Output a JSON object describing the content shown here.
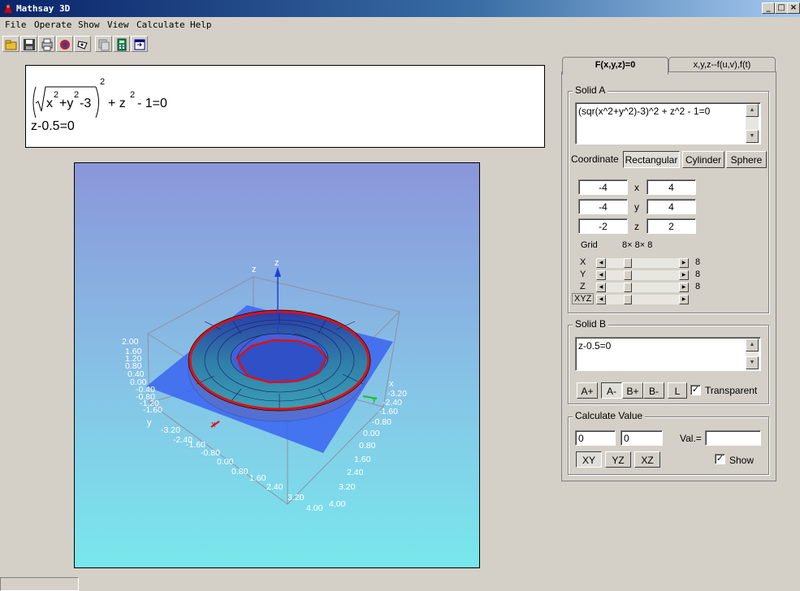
{
  "window": {
    "title": "Mathsay 3D",
    "controls": [
      "_",
      "□",
      "×"
    ]
  },
  "menu": [
    "File",
    "Operate",
    "Show",
    "View",
    "Calculate",
    "Help"
  ],
  "toolbar": [
    "open-icon",
    "save-icon",
    "print-icon",
    "reset-icon",
    "rotate-icon",
    "copy-icon",
    "calculator-icon",
    "window-icon"
  ],
  "formula": {
    "line1": {
      "sqrt_arg": "x",
      "sup_x": "2",
      "plus_y": "+y",
      "sup_y": "2",
      "minus": "-3",
      "outer_sup": "2",
      "rest": "+ z",
      "sup_z": "2",
      "tail": "- 1=0"
    },
    "line2": "z-0.5=0"
  },
  "tabs": {
    "active": "F(x,y,z)=0",
    "inactive": "x,y,z--f(u,v),f(t)"
  },
  "solidA": {
    "label": "Solid A",
    "expression": "(sqr(x^2+y^2)-3)^2 + z^2 - 1=0",
    "coordinate_label": "Coordinate",
    "coord_buttons": [
      "Rectangular",
      "Cylinder",
      "Sphere"
    ],
    "ranges": [
      {
        "min": "-4",
        "axis": "x",
        "max": "4"
      },
      {
        "min": "-4",
        "axis": "y",
        "max": "4"
      },
      {
        "min": "-2",
        "axis": "z",
        "max": "2"
      }
    ],
    "grid_label": "Grid",
    "grid_value": "8× 8× 8",
    "sliders": [
      {
        "label": "X",
        "value": "8"
      },
      {
        "label": "Y",
        "value": "8"
      },
      {
        "label": "Z",
        "value": "8"
      },
      {
        "label": "XYZ",
        "value": ""
      }
    ]
  },
  "solidB": {
    "label": "Solid B",
    "expression": "z-0.5=0",
    "buttons": [
      "A+",
      "A-",
      "B+",
      "B-",
      "L"
    ],
    "transparent_label": "Transparent",
    "transparent_checked": "✓"
  },
  "calculate": {
    "label": "Calculate Value",
    "input1": "0",
    "input2": "0",
    "val_label": "Val.=",
    "val_value": "",
    "buttons": [
      "XY",
      "YZ",
      "XZ"
    ],
    "show_label": "Show",
    "show_checked": "✓"
  },
  "plot": {
    "z_label": "z",
    "z_axis_label": "z",
    "x_label": "x",
    "y_label": "y",
    "x_axis_label": "x",
    "y_axis_label": "y",
    "z_ticks": [
      "2.00",
      "1.60",
      "1.20",
      "0.80",
      "0.40",
      "0.00",
      "-0.40",
      "-0.80",
      "-1.20",
      "-1.60"
    ],
    "x_ticks": [
      "-3.20",
      "-2.40",
      "-1.60",
      "-0.80",
      "0.00",
      "0.80",
      "1.60",
      "2.40",
      "3.20",
      "4.00"
    ],
    "y_ticks": [
      "-3.20",
      "-2.40",
      "-1.60",
      "-0.80",
      "0.00",
      "0.80",
      "1.60",
      "2.40",
      "3.20",
      "4.00"
    ]
  }
}
